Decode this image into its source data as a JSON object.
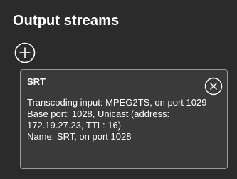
{
  "header": {
    "title": "Output streams"
  },
  "toolbar": {
    "add_icon": "plus-circle-icon"
  },
  "stream": {
    "name": "SRT",
    "close_icon": "close-circle-icon",
    "details": [
      "Transcoding input: MPEG2TS, on port 1029",
      "Base port: 1028, Unicast (address: 172.19.27.23, TTL: 16)",
      "Name: SRT, on port 1028"
    ]
  },
  "colors": {
    "background": "#2b2b2b",
    "card_background": "#3a3a3a",
    "card_border": "#9a9a9a",
    "text": "#ffffff"
  }
}
